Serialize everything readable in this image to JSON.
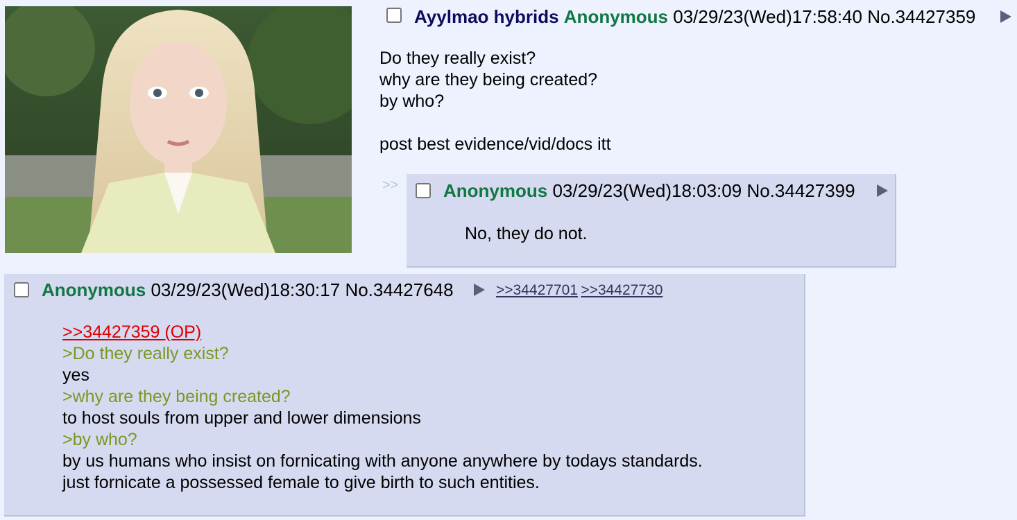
{
  "op": {
    "subject": "Ayylmao hybrids",
    "name": "Anonymous",
    "datetime": "03/29/23(Wed)17:58:40",
    "number": "No.34427359",
    "body": [
      "Do they really exist?",
      "why are they being created?",
      "by who?",
      "",
      "post best evidence/vid/docs itt"
    ]
  },
  "reply1": {
    "marker": ">>",
    "name": "Anonymous",
    "datetime": "03/29/23(Wed)18:03:09",
    "number": "No.34427399",
    "body": "No, they do not."
  },
  "reply2": {
    "name": "Anonymous",
    "datetime": "03/29/23(Wed)18:30:17",
    "number": "No.34427648",
    "backlinks": [
      ">>34427701",
      ">>34427730"
    ],
    "quotelink": ">>34427359 (OP)",
    "lines": [
      {
        "text": ">Do they really exist?",
        "type": "quote"
      },
      {
        "text": "yes",
        "type": "text"
      },
      {
        "text": ">why are they being created?",
        "type": "quote"
      },
      {
        "text": "to host souls from upper and lower dimensions",
        "type": "text"
      },
      {
        "text": ">by who?",
        "type": "quote"
      },
      {
        "text": "by us humans who insist on fornicating with anyone anywhere by todays standards.",
        "type": "text"
      },
      {
        "text": "just fornicate a possessed female to give birth to such entities.",
        "type": "text"
      }
    ]
  },
  "colors": {
    "background": "#eef2ff",
    "reply_bg": "#d6daf0",
    "name": "#117743",
    "subject": "#0f0c5d",
    "greentext": "#789922",
    "quotelink": "#dd0000"
  }
}
